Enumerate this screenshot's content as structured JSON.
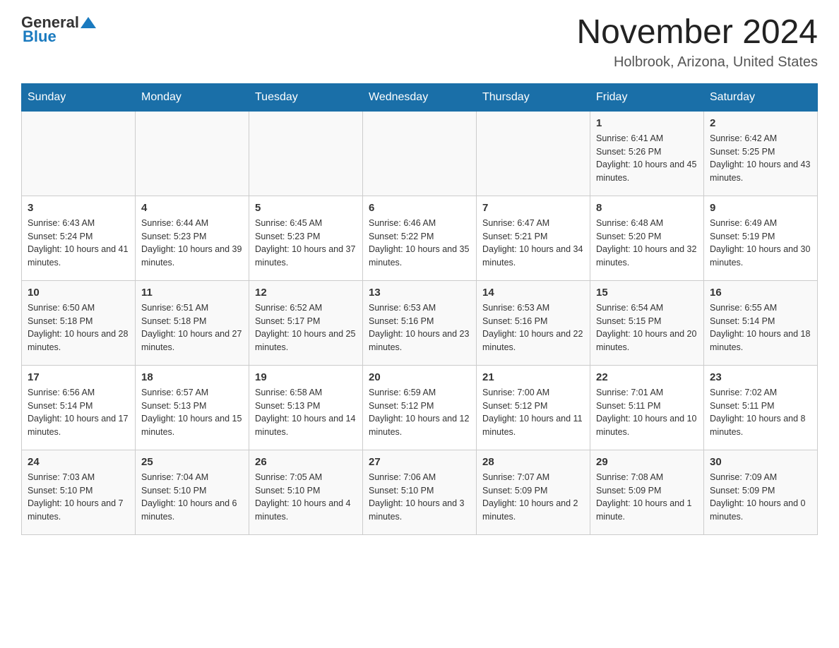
{
  "header": {
    "logo_text_black": "General",
    "logo_text_blue": "Blue",
    "title": "November 2024",
    "subtitle": "Holbrook, Arizona, United States"
  },
  "calendar": {
    "days_of_week": [
      "Sunday",
      "Monday",
      "Tuesday",
      "Wednesday",
      "Thursday",
      "Friday",
      "Saturday"
    ],
    "weeks": [
      [
        {
          "day": "",
          "info": ""
        },
        {
          "day": "",
          "info": ""
        },
        {
          "day": "",
          "info": ""
        },
        {
          "day": "",
          "info": ""
        },
        {
          "day": "",
          "info": ""
        },
        {
          "day": "1",
          "info": "Sunrise: 6:41 AM\nSunset: 5:26 PM\nDaylight: 10 hours and 45 minutes."
        },
        {
          "day": "2",
          "info": "Sunrise: 6:42 AM\nSunset: 5:25 PM\nDaylight: 10 hours and 43 minutes."
        }
      ],
      [
        {
          "day": "3",
          "info": "Sunrise: 6:43 AM\nSunset: 5:24 PM\nDaylight: 10 hours and 41 minutes."
        },
        {
          "day": "4",
          "info": "Sunrise: 6:44 AM\nSunset: 5:23 PM\nDaylight: 10 hours and 39 minutes."
        },
        {
          "day": "5",
          "info": "Sunrise: 6:45 AM\nSunset: 5:23 PM\nDaylight: 10 hours and 37 minutes."
        },
        {
          "day": "6",
          "info": "Sunrise: 6:46 AM\nSunset: 5:22 PM\nDaylight: 10 hours and 35 minutes."
        },
        {
          "day": "7",
          "info": "Sunrise: 6:47 AM\nSunset: 5:21 PM\nDaylight: 10 hours and 34 minutes."
        },
        {
          "day": "8",
          "info": "Sunrise: 6:48 AM\nSunset: 5:20 PM\nDaylight: 10 hours and 32 minutes."
        },
        {
          "day": "9",
          "info": "Sunrise: 6:49 AM\nSunset: 5:19 PM\nDaylight: 10 hours and 30 minutes."
        }
      ],
      [
        {
          "day": "10",
          "info": "Sunrise: 6:50 AM\nSunset: 5:18 PM\nDaylight: 10 hours and 28 minutes."
        },
        {
          "day": "11",
          "info": "Sunrise: 6:51 AM\nSunset: 5:18 PM\nDaylight: 10 hours and 27 minutes."
        },
        {
          "day": "12",
          "info": "Sunrise: 6:52 AM\nSunset: 5:17 PM\nDaylight: 10 hours and 25 minutes."
        },
        {
          "day": "13",
          "info": "Sunrise: 6:53 AM\nSunset: 5:16 PM\nDaylight: 10 hours and 23 minutes."
        },
        {
          "day": "14",
          "info": "Sunrise: 6:53 AM\nSunset: 5:16 PM\nDaylight: 10 hours and 22 minutes."
        },
        {
          "day": "15",
          "info": "Sunrise: 6:54 AM\nSunset: 5:15 PM\nDaylight: 10 hours and 20 minutes."
        },
        {
          "day": "16",
          "info": "Sunrise: 6:55 AM\nSunset: 5:14 PM\nDaylight: 10 hours and 18 minutes."
        }
      ],
      [
        {
          "day": "17",
          "info": "Sunrise: 6:56 AM\nSunset: 5:14 PM\nDaylight: 10 hours and 17 minutes."
        },
        {
          "day": "18",
          "info": "Sunrise: 6:57 AM\nSunset: 5:13 PM\nDaylight: 10 hours and 15 minutes."
        },
        {
          "day": "19",
          "info": "Sunrise: 6:58 AM\nSunset: 5:13 PM\nDaylight: 10 hours and 14 minutes."
        },
        {
          "day": "20",
          "info": "Sunrise: 6:59 AM\nSunset: 5:12 PM\nDaylight: 10 hours and 12 minutes."
        },
        {
          "day": "21",
          "info": "Sunrise: 7:00 AM\nSunset: 5:12 PM\nDaylight: 10 hours and 11 minutes."
        },
        {
          "day": "22",
          "info": "Sunrise: 7:01 AM\nSunset: 5:11 PM\nDaylight: 10 hours and 10 minutes."
        },
        {
          "day": "23",
          "info": "Sunrise: 7:02 AM\nSunset: 5:11 PM\nDaylight: 10 hours and 8 minutes."
        }
      ],
      [
        {
          "day": "24",
          "info": "Sunrise: 7:03 AM\nSunset: 5:10 PM\nDaylight: 10 hours and 7 minutes."
        },
        {
          "day": "25",
          "info": "Sunrise: 7:04 AM\nSunset: 5:10 PM\nDaylight: 10 hours and 6 minutes."
        },
        {
          "day": "26",
          "info": "Sunrise: 7:05 AM\nSunset: 5:10 PM\nDaylight: 10 hours and 4 minutes."
        },
        {
          "day": "27",
          "info": "Sunrise: 7:06 AM\nSunset: 5:10 PM\nDaylight: 10 hours and 3 minutes."
        },
        {
          "day": "28",
          "info": "Sunrise: 7:07 AM\nSunset: 5:09 PM\nDaylight: 10 hours and 2 minutes."
        },
        {
          "day": "29",
          "info": "Sunrise: 7:08 AM\nSunset: 5:09 PM\nDaylight: 10 hours and 1 minute."
        },
        {
          "day": "30",
          "info": "Sunrise: 7:09 AM\nSunset: 5:09 PM\nDaylight: 10 hours and 0 minutes."
        }
      ]
    ]
  }
}
